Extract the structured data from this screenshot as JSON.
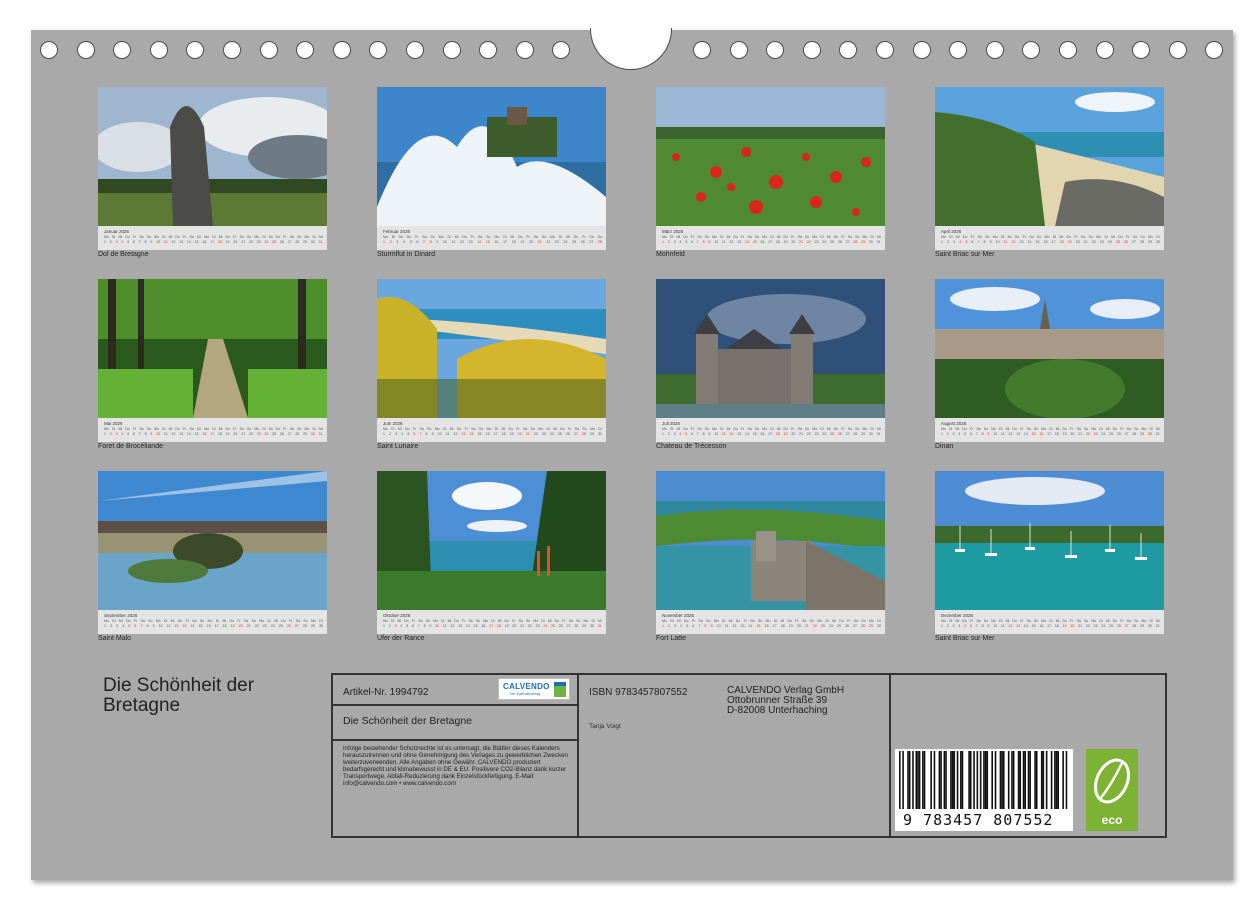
{
  "months": [
    {
      "month_label": "Januar 2026",
      "caption": "Dol de Bretagne",
      "days": 31,
      "weekends": [
        3,
        4,
        10,
        11,
        17,
        18,
        24,
        25,
        31
      ]
    },
    {
      "month_label": "Februar 2026",
      "caption": "Sturmflut in Dinard",
      "days": 28,
      "weekends": [
        1,
        7,
        8,
        14,
        15,
        21,
        22,
        28
      ]
    },
    {
      "month_label": "März 2026",
      "caption": "Mohnfeld",
      "days": 31,
      "weekends": [
        1,
        7,
        8,
        14,
        15,
        21,
        22,
        28,
        29
      ]
    },
    {
      "month_label": "April 2026",
      "caption": "Saint Briac sur Mer",
      "days": 30,
      "weekends": [
        4,
        5,
        11,
        12,
        18,
        19,
        25,
        26
      ]
    },
    {
      "month_label": "Mai 2026",
      "caption": "Foret de Brocéliande",
      "days": 31,
      "weekends": [
        2,
        3,
        9,
        10,
        16,
        17,
        23,
        24,
        30,
        31
      ]
    },
    {
      "month_label": "Juni 2026",
      "caption": "Saint Lunaire",
      "days": 30,
      "weekends": [
        6,
        7,
        13,
        14,
        20,
        21,
        27,
        28
      ]
    },
    {
      "month_label": "Juli 2026",
      "caption": "Chateau de Trécesson",
      "days": 31,
      "weekends": [
        4,
        5,
        11,
        12,
        18,
        19,
        25,
        26
      ]
    },
    {
      "month_label": "August 2026",
      "caption": "Dinan",
      "days": 31,
      "weekends": [
        1,
        2,
        8,
        9,
        15,
        16,
        22,
        23,
        29,
        30
      ]
    },
    {
      "month_label": "September 2026",
      "caption": "Saint Malo",
      "days": 30,
      "weekends": [
        5,
        6,
        12,
        13,
        19,
        20,
        26,
        27
      ]
    },
    {
      "month_label": "Oktober 2026",
      "caption": "Ufer der Rance",
      "days": 31,
      "weekends": [
        3,
        4,
        10,
        11,
        17,
        18,
        24,
        25,
        31
      ]
    },
    {
      "month_label": "November 2026",
      "caption": "Fort Latte",
      "days": 30,
      "weekends": [
        1,
        7,
        8,
        14,
        15,
        21,
        22,
        28,
        29
      ]
    },
    {
      "month_label": "Dezember 2026",
      "caption": "Saint Briac sur Mer",
      "days": 31,
      "weekends": [
        5,
        6,
        12,
        13,
        19,
        20,
        26,
        27
      ]
    }
  ],
  "cover_title": "Die Schönheit der Bretagne",
  "info": {
    "article_number": "Artikel-Nr. 1994792",
    "logo_text": "CALVENDO",
    "logo_sub": "Der Kalenderverlag",
    "subtitle": "Die Schönheit der Bretagne",
    "legal": "Infolge bestehender Schutzrechte ist es untersagt, die Blätter dieses Kalenders herauszutrennen und ohne Genehmigung des Verlages zu gewerblichen Zwecken weiterzuverwenden. Alle Angaben ohne Gewähr. CALVENDO produziert bedarfsgerecht und klimabewusst in DE & EU. Positivere CO2-Bilanz dank kurzer Transportwege. Abfall-Reduzierung dank Einzelstückfertigung. E-Mail: info@calvendo.com • www.calvendo.com",
    "isbn": "ISBN 9783457807552",
    "publisher_line1": "CALVENDO Verlag GmbH",
    "publisher_line2": "Ottobrunner Straße 39",
    "publisher_line3": "D-82008 Unterhaching",
    "author": "Tanja Voigt",
    "barcode_number": "9 783457 807552",
    "eco_label": "eco"
  }
}
